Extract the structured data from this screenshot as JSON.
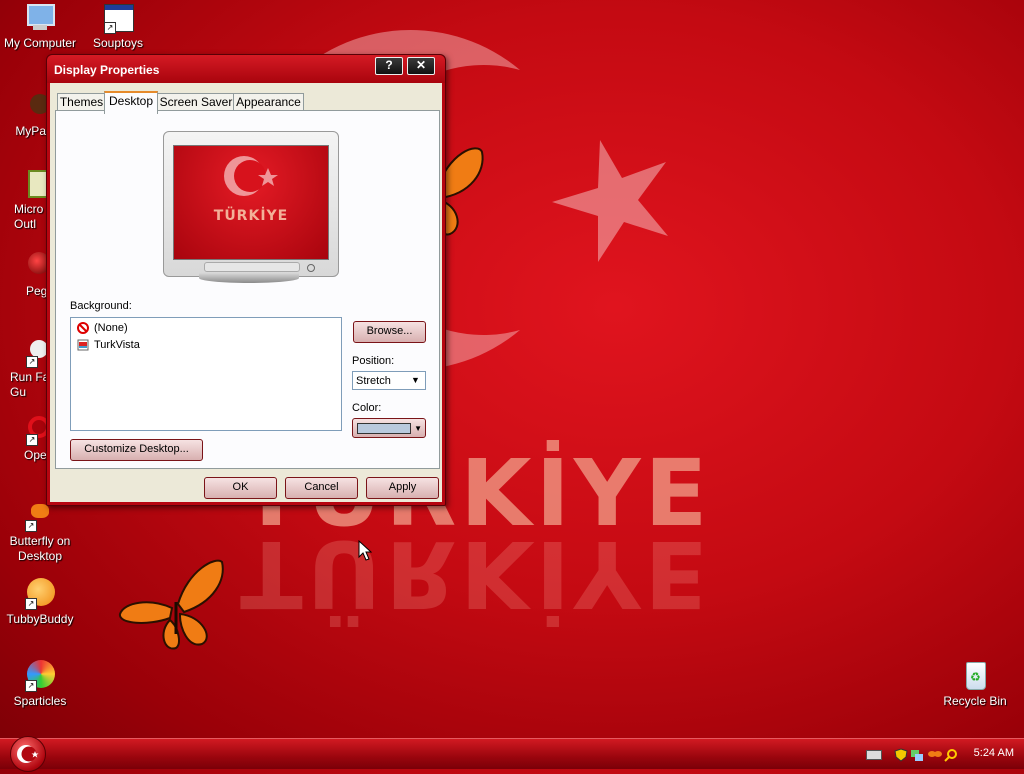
{
  "desktop": {
    "wallpaper_text": "TÜRKİYE",
    "icons": [
      {
        "label": "My Computer",
        "icon": "computer-icon"
      },
      {
        "label": "Souptoys",
        "icon": "window-icon"
      },
      {
        "label": "MyPa",
        "icon": "mypa-icon"
      },
      {
        "label": "Micro\nOutl",
        "icon": "outlook-icon"
      },
      {
        "label": "Peg",
        "icon": "peg-icon"
      },
      {
        "label": "Run Fa\nGu",
        "icon": "run-icon"
      },
      {
        "label": "Ope",
        "icon": "opera-icon"
      },
      {
        "label": "Butterfly on\nDesktop",
        "icon": "butterfly-icon"
      },
      {
        "label": "TubbyBuddy",
        "icon": "tubbybuddy-icon"
      },
      {
        "label": "Sparticles",
        "icon": "sparticles-icon"
      },
      {
        "label": "Recycle Bin",
        "icon": "recycle-bin-icon"
      }
    ]
  },
  "dialog": {
    "title": "Display Properties",
    "help_btn": "?",
    "close_btn": "✕",
    "tabs": [
      "Themes",
      "Desktop",
      "Screen Saver",
      "Appearance"
    ],
    "active_tab": "Desktop",
    "preview_text": "TÜRKİYE",
    "background_label": "Background:",
    "background_items": [
      {
        "label": "(None)",
        "icon": "none-icon"
      },
      {
        "label": "TurkVista",
        "icon": "image-file-icon"
      }
    ],
    "browse_label": "Browse...",
    "position_label": "Position:",
    "position_value": "Stretch",
    "color_label": "Color:",
    "color_value": "#b9c9dd",
    "customize_label": "Customize Desktop...",
    "ok_label": "OK",
    "cancel_label": "Cancel",
    "apply_label": "Apply"
  },
  "taskbar": {
    "clock": "5:24 AM"
  }
}
